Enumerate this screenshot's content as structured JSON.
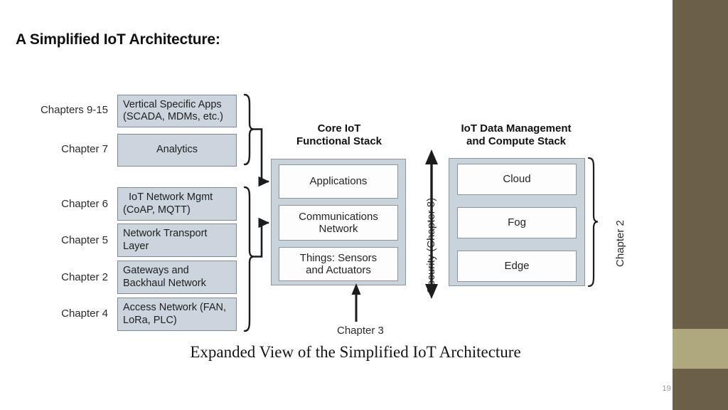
{
  "slide": {
    "title": "A Simplified IoT Architecture:",
    "number": "19",
    "accent_color": "#6b5f47",
    "accent_band_color": "#afa87c"
  },
  "figure": {
    "caption": "Expanded View of the Simplified IoT Architecture",
    "box_fill": "#ccd5dd",
    "container_fill": "#c9d3dc",
    "inner_fill": "#fdfdfd",
    "border_color": "#8a959d",
    "left_stack": {
      "upper_group": [
        {
          "chapter": "Chapters 9-15",
          "lines": [
            "Vertical Specific Apps",
            "(SCADA, MDMs, etc.)"
          ]
        },
        {
          "chapter": "Chapter 7",
          "lines": [
            "Analytics"
          ]
        }
      ],
      "lower_group": [
        {
          "chapter": "Chapter 6",
          "lines": [
            "IoT Network Mgmt",
            "(CoAP, MQTT)"
          ]
        },
        {
          "chapter": "Chapter 5",
          "lines": [
            "Network Transport",
            "Layer"
          ]
        },
        {
          "chapter": "Chapter 2",
          "lines": [
            "Gateways and",
            "Backhaul Network"
          ]
        },
        {
          "chapter": "Chapter 4",
          "lines": [
            "Access Network (FAN,",
            "LoRa, PLC)"
          ]
        }
      ]
    },
    "center_stack": {
      "heading": [
        "Core IoT",
        "Functional Stack"
      ],
      "layers": [
        {
          "lines": [
            "Applications"
          ]
        },
        {
          "lines": [
            "Communications",
            "Network"
          ]
        },
        {
          "lines": [
            "Things: Sensors",
            "and Actuators"
          ]
        }
      ],
      "bottom_arrow_label": "Chapter 3"
    },
    "right_stack": {
      "heading": [
        "IoT Data Management",
        "and Compute Stack"
      ],
      "layers": [
        {
          "lines": [
            "Cloud"
          ]
        },
        {
          "lines": [
            "Fog"
          ]
        },
        {
          "lines": [
            "Edge"
          ]
        }
      ],
      "bracket_label": "Chapter 2"
    },
    "security_axis": {
      "label": "Security (Chapter 8)"
    }
  }
}
